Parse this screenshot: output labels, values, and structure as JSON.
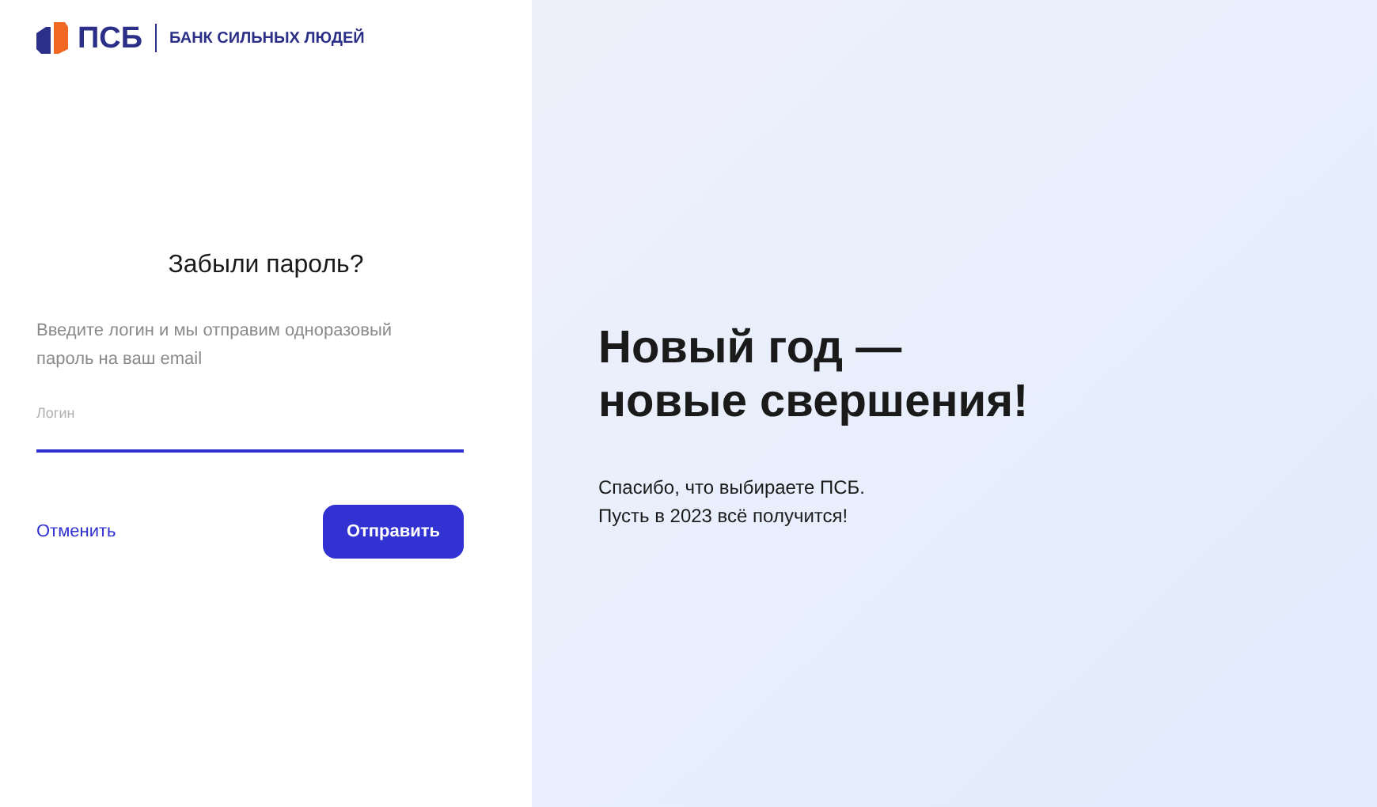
{
  "logo": {
    "brand": "ПСБ",
    "tagline": "БАНК СИЛЬНЫХ ЛЮДЕЙ"
  },
  "form": {
    "title": "Забыли пароль?",
    "description": "Введите логин и мы отправим одноразовый пароль на ваш email",
    "login_field": {
      "label": "Логин"
    },
    "cancel_link": "Отменить",
    "submit_button": "Отправить"
  },
  "promo": {
    "heading_lines": [
      "Новый год —",
      "новые свершения!"
    ],
    "text_lines": [
      "Спасибо, что выбираете ПСБ.",
      "Пусть в 2023 всё получится!"
    ]
  }
}
